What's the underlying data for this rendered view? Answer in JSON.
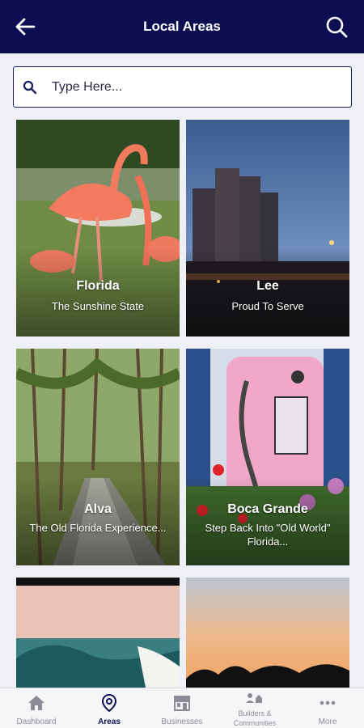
{
  "header": {
    "title": "Local Areas",
    "back_icon": "arrow-left-icon",
    "search_icon": "search-icon"
  },
  "search": {
    "placeholder": "Type Here..."
  },
  "areas": [
    {
      "name": "Florida",
      "tagline": "The Sunshine State"
    },
    {
      "name": "Lee",
      "tagline": "Proud To Serve"
    },
    {
      "name": "Alva",
      "tagline": "The Old Florida Experience..."
    },
    {
      "name": "Boca Grande",
      "tagline": "Step Back Into \"Old World\" Florida..."
    }
  ],
  "bottom_nav": {
    "items": [
      {
        "label": "Dashboard",
        "icon": "home-icon"
      },
      {
        "label": "Areas",
        "icon": "location-pin-icon"
      },
      {
        "label": "Businesses",
        "icon": "storefront-icon"
      },
      {
        "label": "Builders & Communities",
        "icon": "people-houses-icon"
      },
      {
        "label": "More",
        "icon": "ellipsis-icon"
      }
    ],
    "active": "Areas"
  },
  "colors": {
    "header_bg": "#0d0e52",
    "page_bg": "#eef0f6",
    "nav_active": "#0d0e52",
    "nav_inactive": "#8c8c96"
  }
}
